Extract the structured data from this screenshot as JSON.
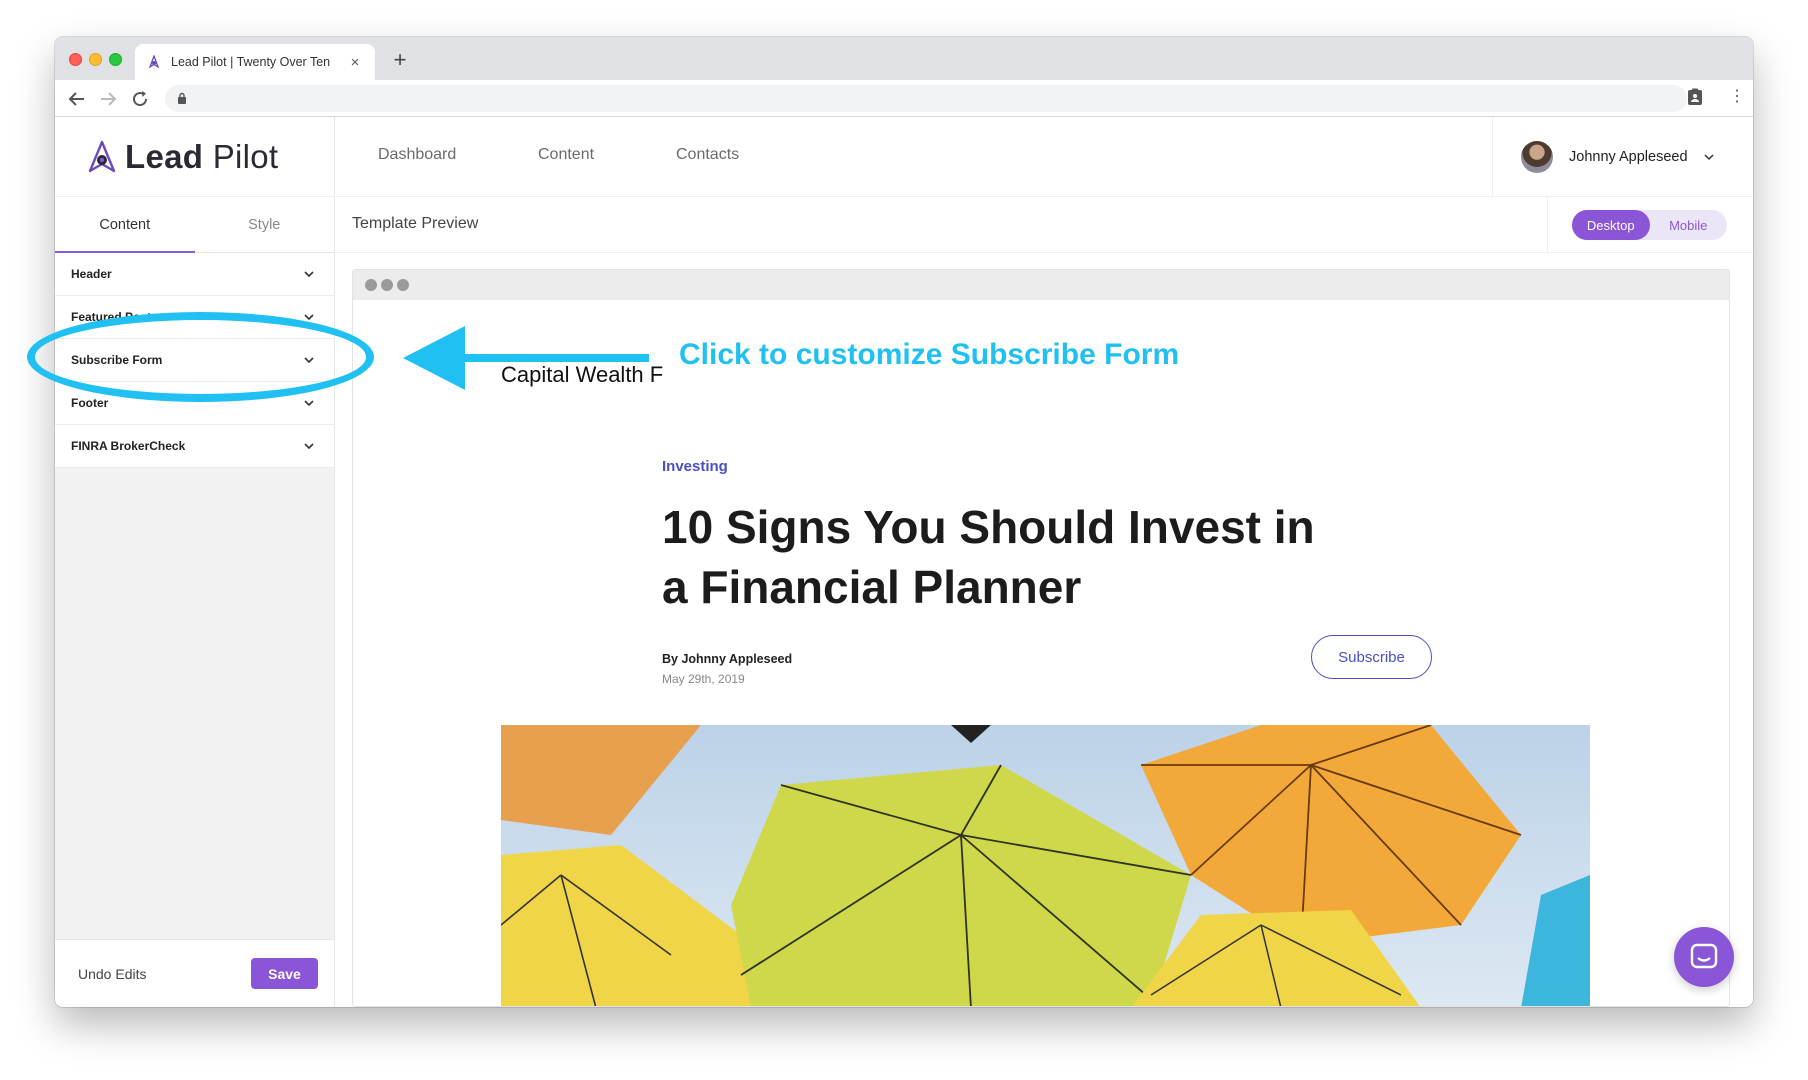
{
  "browser": {
    "tab_title": "Lead Pilot | Twenty Over Ten",
    "tab_close": "×",
    "new_tab": "+"
  },
  "app": {
    "logo_bold": "Lead",
    "logo_light": "Pilot",
    "accent_color": "#8a55d6"
  },
  "topnav": {
    "links": [
      "Dashboard",
      "Content",
      "Contacts"
    ],
    "user_name": "Johnny Appleseed"
  },
  "sidebar": {
    "tabs": [
      {
        "label": "Content",
        "active": true
      },
      {
        "label": "Style",
        "active": false
      }
    ],
    "sections": [
      "Header",
      "Featured Post",
      "Subscribe Form",
      "Footer",
      "FINRA BrokerCheck"
    ],
    "undo_label": "Undo Edits",
    "save_label": "Save"
  },
  "preview": {
    "title": "Template Preview",
    "view_options": [
      {
        "label": "Desktop",
        "active": true
      },
      {
        "label": "Mobile",
        "active": false
      }
    ]
  },
  "site": {
    "brand": "Capital Wealth F",
    "category": "Investing",
    "title": "10 Signs You Should Invest in a Financial Planner",
    "byline": "By Johnny Appleseed",
    "date": "May 29th, 2019",
    "subscribe_label": "Subscribe"
  },
  "annotation": {
    "text": "Click to customize Subscribe Form",
    "color": "#21c0f2"
  }
}
